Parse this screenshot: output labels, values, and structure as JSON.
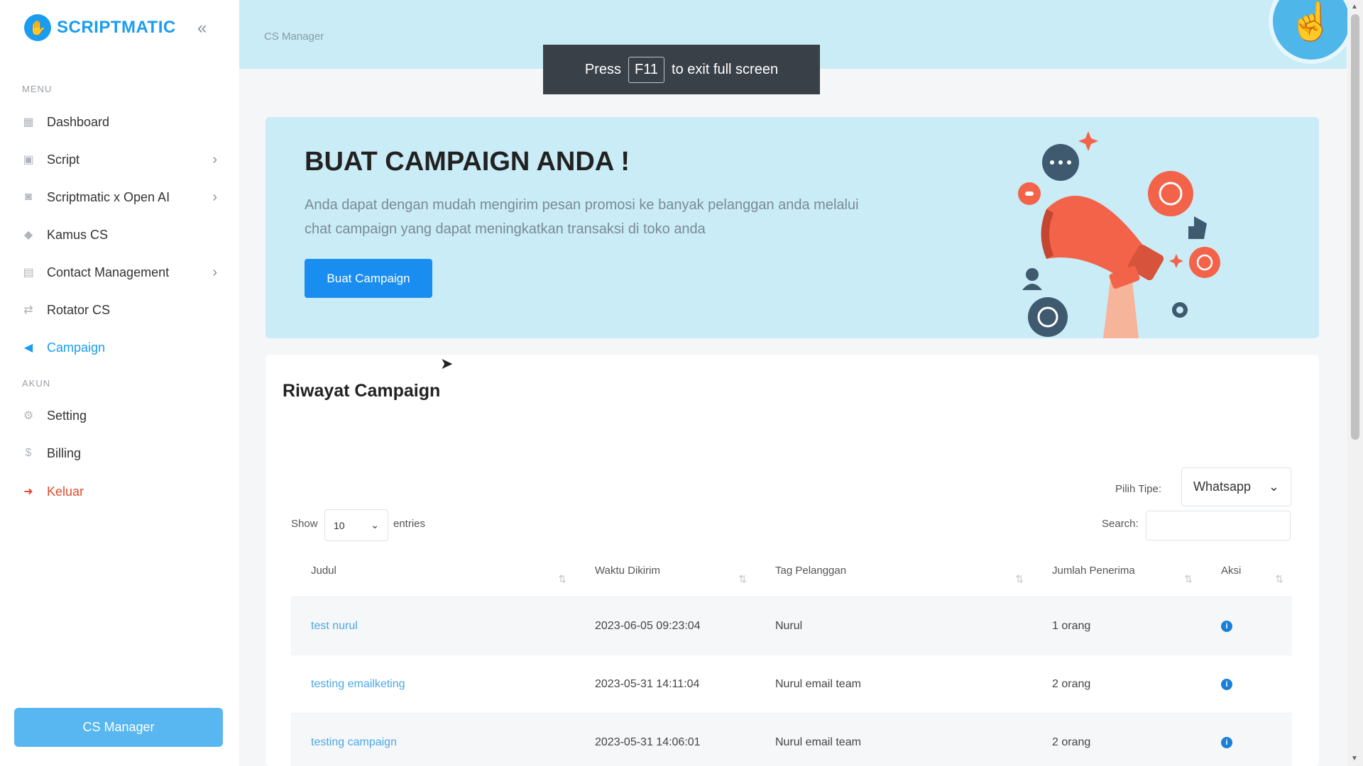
{
  "brand": {
    "name": "SCRIPTMATIC",
    "collapse_icon": "«"
  },
  "sidebar": {
    "menu_label": "MENU",
    "account_label": "AKUN",
    "items": [
      {
        "label": "Dashboard",
        "icon": "dashboard-icon"
      },
      {
        "label": "Script",
        "icon": "script-icon"
      },
      {
        "label": "Scriptmatic x Open AI",
        "icon": "robot-icon"
      },
      {
        "label": "Kamus CS",
        "icon": "book-icon"
      },
      {
        "label": "Contact Management",
        "icon": "contacts-icon"
      },
      {
        "label": "Rotator CS",
        "icon": "rotate-icon"
      },
      {
        "label": "Campaign",
        "icon": "megaphone-icon"
      }
    ],
    "account_items": [
      {
        "label": "Setting",
        "icon": "gear-icon"
      },
      {
        "label": "Billing",
        "icon": "billing-icon"
      },
      {
        "label": "Keluar",
        "icon": "logout-icon"
      }
    ],
    "cs_manager_button": "CS Manager"
  },
  "header": {
    "breadcrumb": "CS Manager"
  },
  "fullscreen_toast": {
    "prefix": "Press",
    "key": "F11",
    "suffix": "to exit full screen"
  },
  "banner": {
    "title": "BUAT CAMPAIGN ANDA !",
    "description": "Anda dapat dengan mudah mengirim pesan promosi ke banyak pelanggan anda melalui chat campaign yang dapat meningkatkan transaksi di toko anda",
    "button": "Buat Campaign"
  },
  "history": {
    "title": "Riwayat Campaign",
    "type_label": "Pilih Tipe:",
    "type_value": "Whatsapp",
    "show_label": "Show",
    "show_value": "10",
    "entries_label": "entries",
    "search_label": "Search:",
    "columns": [
      "Judul",
      "Waktu Dikirim",
      "Tag Pelanggan",
      "Jumlah Penerima",
      "Aksi"
    ],
    "rows": [
      {
        "judul": "test nurul",
        "waktu": "2023-06-05 09:23:04",
        "tag": "Nurul",
        "jumlah": "1 orang"
      },
      {
        "judul": "testing emailketing",
        "waktu": "2023-05-31 14:11:04",
        "tag": "Nurul email team",
        "jumlah": "2 orang"
      },
      {
        "judul": "testing campaign",
        "waktu": "2023-05-31 14:06:01",
        "tag": "Nurul email team",
        "jumlah": "2 orang"
      }
    ]
  },
  "colors": {
    "accent": "#1a9cf0",
    "banner_bg": "#c9ecf6",
    "logout": "#e24a2c",
    "cs_button": "#58b6f0"
  }
}
